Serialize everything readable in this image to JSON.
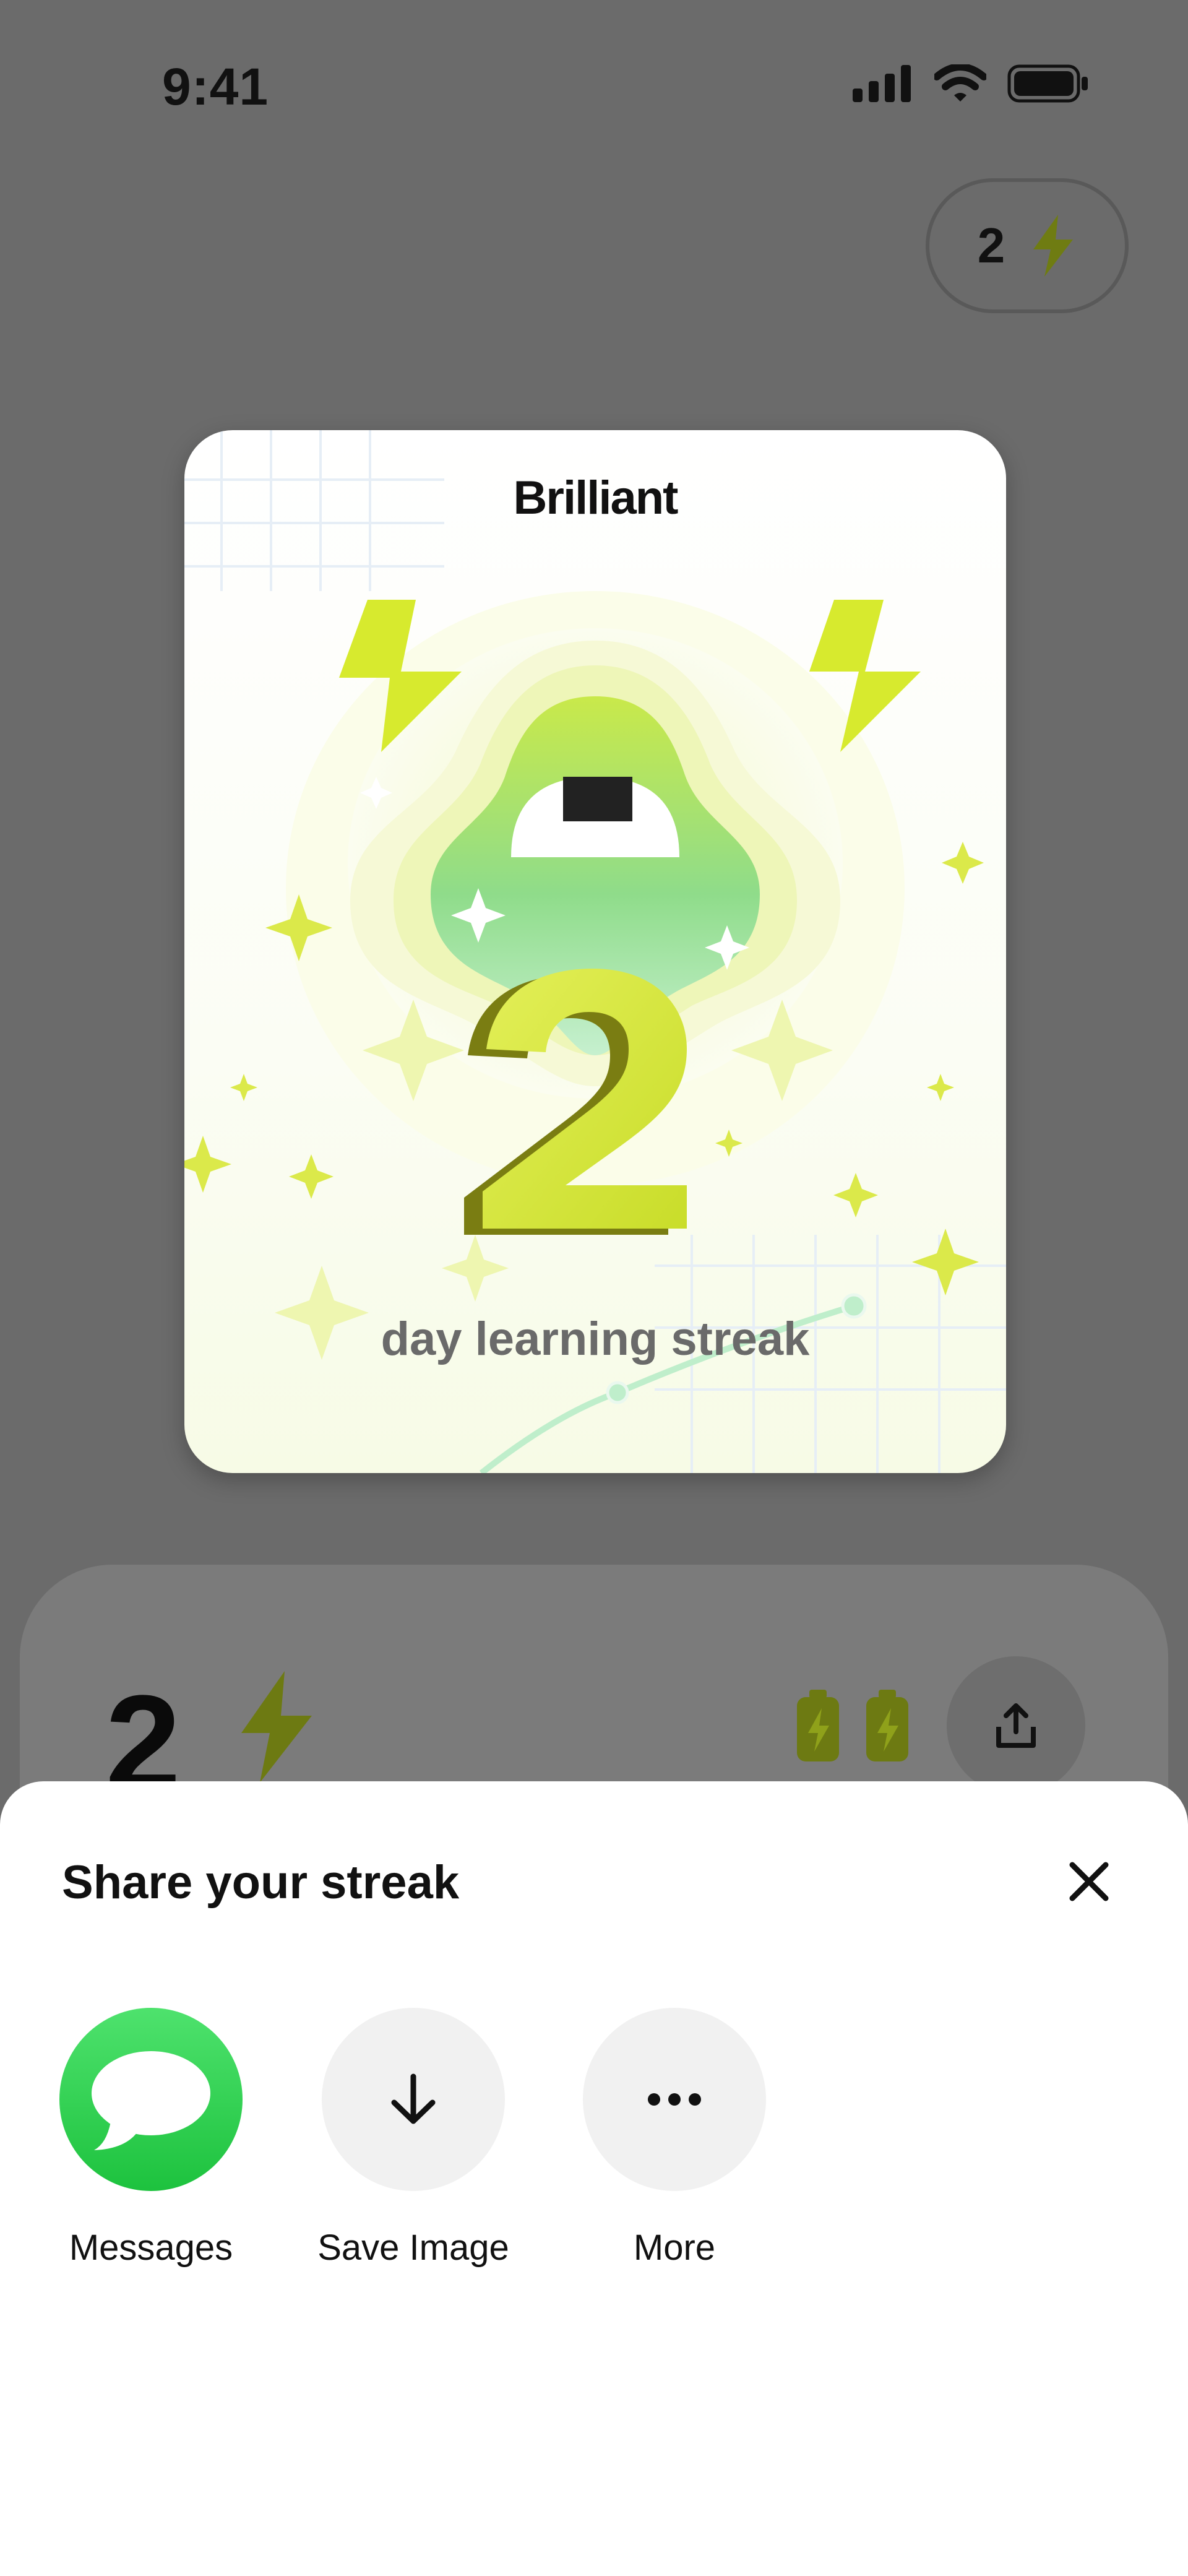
{
  "status_bar": {
    "time": "9:41"
  },
  "streak_pill": {
    "count": "2"
  },
  "card": {
    "brand": "Brilliant",
    "streak_number": "2",
    "caption": "day learning streak"
  },
  "back_panel": {
    "count": "2"
  },
  "sheet": {
    "title": "Share your streak",
    "options": [
      {
        "label": "Messages",
        "icon": "messages-icon"
      },
      {
        "label": "Save Image",
        "icon": "download-icon"
      },
      {
        "label": "More",
        "icon": "more-icon"
      }
    ]
  },
  "colors": {
    "accent_lime": "#d4e635",
    "messages_green": "#2ed14f",
    "bolt_olive": "#7a8a10"
  }
}
